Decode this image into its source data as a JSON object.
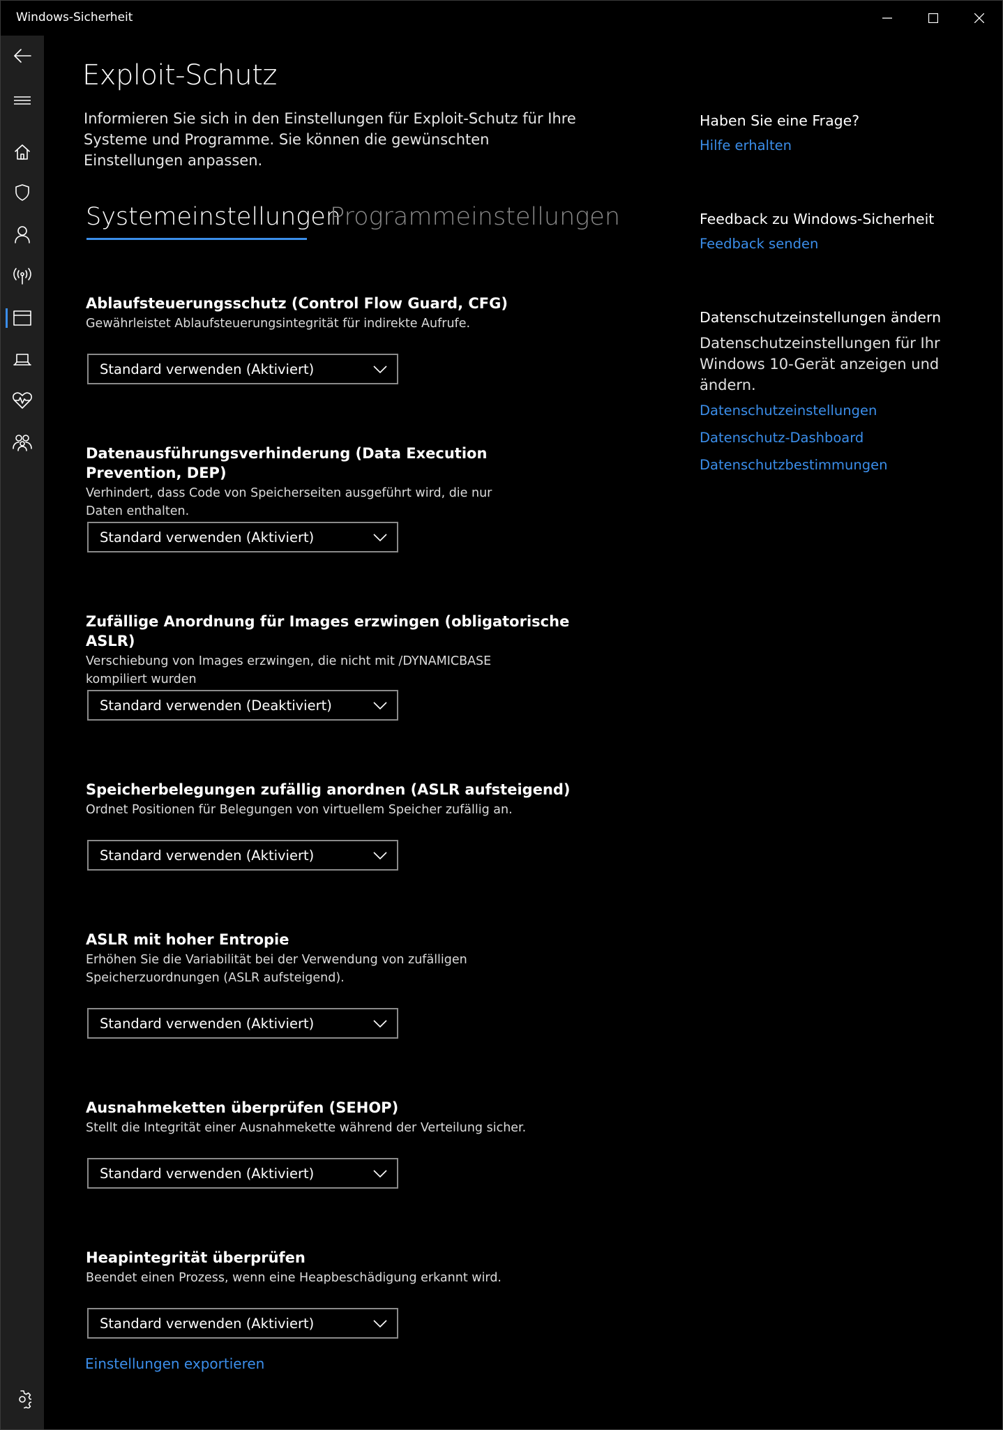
{
  "window": {
    "title": "Windows-Sicherheit"
  },
  "nav": {
    "items": [
      {
        "icon": "back-arrow-icon"
      },
      {
        "icon": "hamburger-menu-icon"
      },
      {
        "icon": "home-icon"
      },
      {
        "icon": "shield-icon"
      },
      {
        "icon": "person-icon"
      },
      {
        "icon": "wireless-antenna-icon"
      },
      {
        "icon": "app-browser-icon",
        "active": true
      },
      {
        "icon": "laptop-icon"
      },
      {
        "icon": "heart-health-icon"
      },
      {
        "icon": "family-icon"
      },
      {
        "icon": "settings-gear-icon"
      }
    ]
  },
  "main": {
    "title": "Exploit-Schutz",
    "description": "Informieren Sie sich in den Einstellungen für Exploit-Schutz für Ihre Systeme und Programme. Sie können die gewünschten Einstellungen anpassen.",
    "tabs": [
      {
        "label": "Systemeinstellungen",
        "active": true
      },
      {
        "label": "Programmeinstellungen",
        "active": false
      }
    ],
    "settings": [
      {
        "title": "Ablaufsteuerungsschutz (Control Flow Guard, CFG)",
        "description": "Gewährleistet Ablaufsteuerungsintegrität für indirekte Aufrufe.",
        "value": "Standard verwenden (Aktiviert)"
      },
      {
        "title": "Datenausführungsverhinderung (Data Execution Prevention, DEP)",
        "description": "Verhindert, dass Code von Speicherseiten ausgeführt wird, die nur Daten enthalten.",
        "value": "Standard verwenden (Aktiviert)"
      },
      {
        "title": "Zufällige Anordnung für Images erzwingen (obligatorische ASLR)",
        "description": "Verschiebung von Images erzwingen, die nicht mit /DYNAMICBASE kompiliert wurden",
        "value": "Standard verwenden (Deaktiviert)"
      },
      {
        "title": "Speicherbelegungen zufällig anordnen (ASLR aufsteigend)",
        "description": "Ordnet Positionen für Belegungen von virtuellem Speicher zufällig an.",
        "value": "Standard verwenden (Aktiviert)"
      },
      {
        "title": "ASLR mit hoher Entropie",
        "description": "Erhöhen Sie die Variabilität bei der Verwendung von zufälligen Speicherzuordnungen (ASLR aufsteigend).",
        "value": "Standard verwenden (Aktiviert)"
      },
      {
        "title": "Ausnahmeketten überprüfen (SEHOP)",
        "description": "Stellt die Integrität einer Ausnahmekette während der Verteilung sicher.",
        "value": "Standard verwenden (Aktiviert)"
      },
      {
        "title": "Heapintegrität überprüfen",
        "description": "Beendet einen Prozess, wenn eine Heapbeschädigung erkannt wird.",
        "value": "Standard verwenden (Aktiviert)"
      }
    ],
    "export_link": "Einstellungen exportieren"
  },
  "side": {
    "question_heading": "Haben Sie eine Frage?",
    "help_link": "Hilfe erhalten",
    "feedback_heading": "Feedback zu Windows-Sicherheit",
    "feedback_link": "Feedback senden",
    "privacy_heading": "Datenschutzeinstellungen ändern",
    "privacy_text": "Datenschutzeinstellungen für Ihr Windows 10-Gerät anzeigen und ändern.",
    "privacy_links": [
      "Datenschutzeinstellungen",
      "Datenschutz-Dashboard",
      "Datenschutzbestimmungen"
    ]
  },
  "colors": {
    "accent": "#3b8eea",
    "nav_background": "#1f1f1f",
    "background": "#000000",
    "inactive_tab": "#8a8a8a"
  }
}
